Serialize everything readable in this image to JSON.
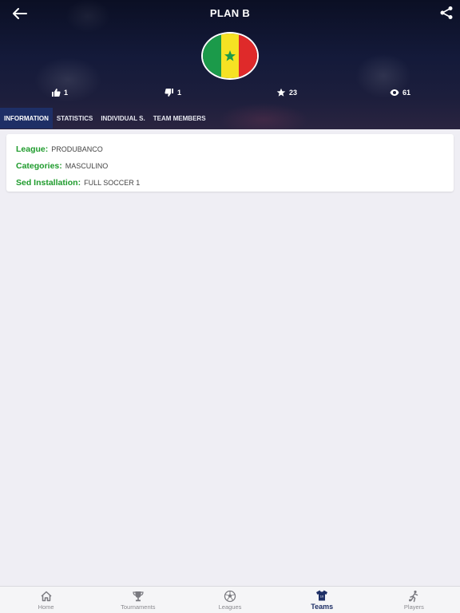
{
  "header": {
    "title": "PLAN B",
    "flag_colors": [
      "#1b9a4a",
      "#f6e223",
      "#df2a2a"
    ],
    "back_icon": "arrow-left-icon",
    "share_icon": "share-icon"
  },
  "stats": {
    "likes": "1",
    "dislikes": "1",
    "stars": "23",
    "views": "61"
  },
  "tabs": [
    {
      "label": "INFORMATION",
      "active": true
    },
    {
      "label": "STATISTICS",
      "active": false
    },
    {
      "label": "INDIVIDUAL S.",
      "active": false
    },
    {
      "label": "TEAM MEMBERS",
      "active": false
    }
  ],
  "info": {
    "league_label": "League:",
    "league_value": "PRODUBANCO",
    "categories_label": "Categories:",
    "categories_value": "MASCULINO",
    "installation_label": "Sed Installation:",
    "installation_value": "FULL SOCCER 1"
  },
  "bottom_nav": [
    {
      "label": "Home",
      "icon": "home-icon",
      "active": false
    },
    {
      "label": "Tournaments",
      "icon": "trophy-icon",
      "active": false
    },
    {
      "label": "Leagues",
      "icon": "soccer-ball-icon",
      "active": false
    },
    {
      "label": "Teams",
      "icon": "jersey-icon",
      "active": true
    },
    {
      "label": "Players",
      "icon": "player-kick-icon",
      "active": false
    }
  ],
  "colors": {
    "accent": "#1e2f66",
    "label_green": "#1e9b2c",
    "background": "#efeef4"
  }
}
